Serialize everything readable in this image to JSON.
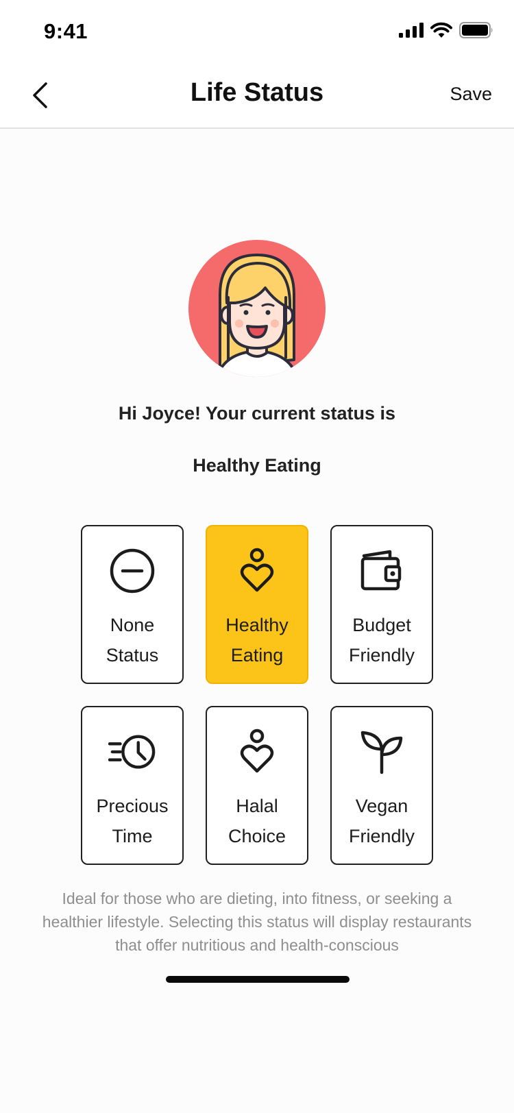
{
  "status_bar": {
    "time": "9:41"
  },
  "nav": {
    "title": "Life Status",
    "save_label": "Save"
  },
  "greeting": "Hi Joyce! Your current status is",
  "current_status": "Healthy Eating",
  "statuses": [
    {
      "line1": "None",
      "line2": "Status",
      "icon": "minus-circle-icon",
      "selected": false
    },
    {
      "line1": "Healthy",
      "line2": "Eating",
      "icon": "person-heart-icon",
      "selected": true
    },
    {
      "line1": "Budget",
      "line2": "Friendly",
      "icon": "wallet-icon",
      "selected": false
    },
    {
      "line1": "Precious",
      "line2": "Time",
      "icon": "fast-clock-icon",
      "selected": false
    },
    {
      "line1": "Halal",
      "line2": "Choice",
      "icon": "person-heart-icon",
      "selected": false
    },
    {
      "line1": "Vegan",
      "line2": "Friendly",
      "icon": "sprout-icon",
      "selected": false
    }
  ],
  "description": "Ideal for those who are dieting, into fitness, or seeking a healthier lifestyle. Selecting this status will display restaurants that offer nutritious and health-conscious",
  "colors": {
    "accent": "#fcc419",
    "avatar_bg": "#f56b6b",
    "hair": "#fdd26b"
  }
}
